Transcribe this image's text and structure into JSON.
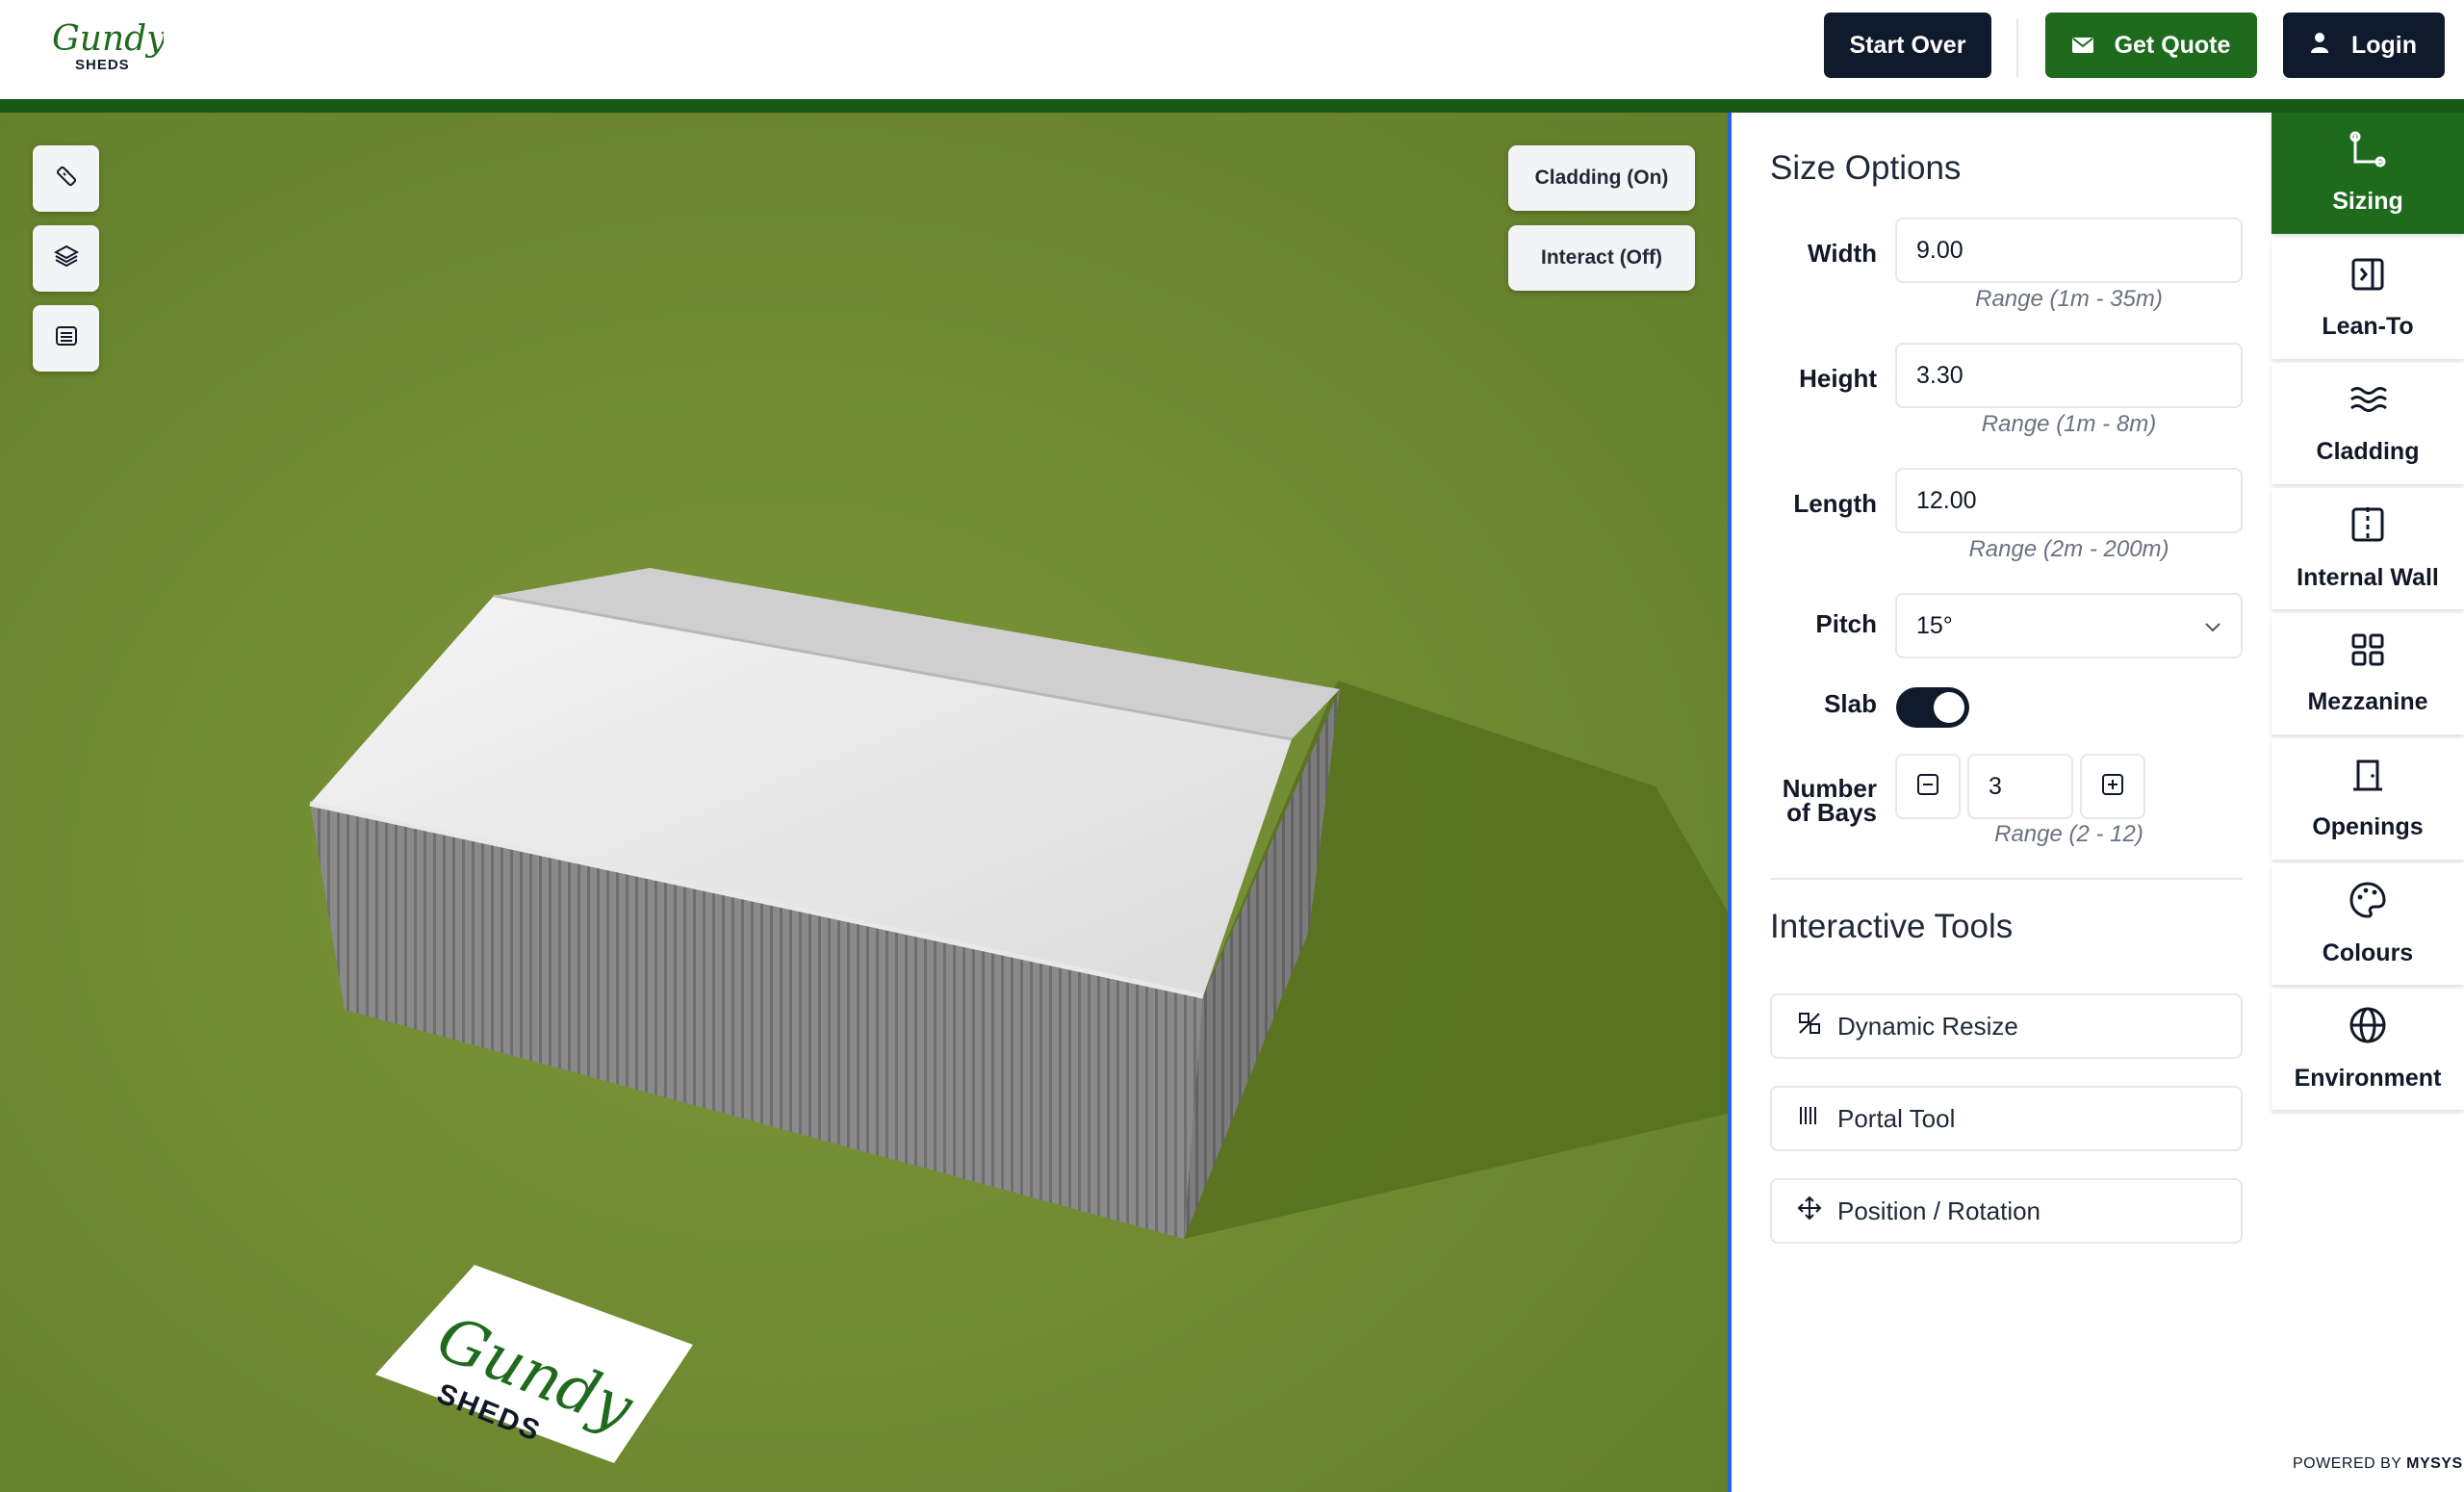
{
  "header": {
    "logo_script": "Gundy",
    "logo_sub": "SHEDS",
    "start_over": "Start Over",
    "get_quote": "Get Quote",
    "login": "Login"
  },
  "viewport": {
    "cladding_toggle": "Cladding (On)",
    "interact_toggle": "Interact (Off)",
    "tools": [
      "ruler-icon",
      "layers-icon",
      "list-icon"
    ],
    "sign_script": "Gundy",
    "sign_sub": "SHEDS"
  },
  "panel": {
    "title": "Size Options",
    "width": {
      "label": "Width",
      "value": "9.00",
      "range": "Range (1m - 35m)"
    },
    "height": {
      "label": "Height",
      "value": "3.30",
      "range": "Range (1m - 8m)"
    },
    "length": {
      "label": "Length",
      "value": "12.00",
      "range": "Range (2m - 200m)"
    },
    "pitch": {
      "label": "Pitch",
      "value": "15°"
    },
    "slab": {
      "label": "Slab",
      "on": true
    },
    "bays": {
      "label_line1": "Number",
      "label_line2": "of Bays",
      "value": "3",
      "range": "Range (2 - 12)"
    },
    "tools_title": "Interactive Tools",
    "tools": {
      "dynamic_resize": "Dynamic Resize",
      "portal_tool": "Portal Tool",
      "position_rotation": "Position / Rotation"
    }
  },
  "rail": {
    "items": [
      {
        "label": "Sizing",
        "icon": "sizing-icon",
        "active": true
      },
      {
        "label": "Lean-To",
        "icon": "lean-to-icon"
      },
      {
        "label": "Cladding",
        "icon": "cladding-icon"
      },
      {
        "label": "Internal Wall",
        "icon": "internal-wall-icon"
      },
      {
        "label": "Mezzanine",
        "icon": "mezzanine-icon"
      },
      {
        "label": "Openings",
        "icon": "openings-icon"
      },
      {
        "label": "Colours",
        "icon": "palette-icon"
      },
      {
        "label": "Environment",
        "icon": "globe-icon"
      }
    ],
    "powered_prefix": "POWERED BY",
    "powered_brand": "MYSYS"
  },
  "colors": {
    "brand_green": "#1e6b1e",
    "navy": "#0f1b2d",
    "grass": "#6f8a32"
  }
}
